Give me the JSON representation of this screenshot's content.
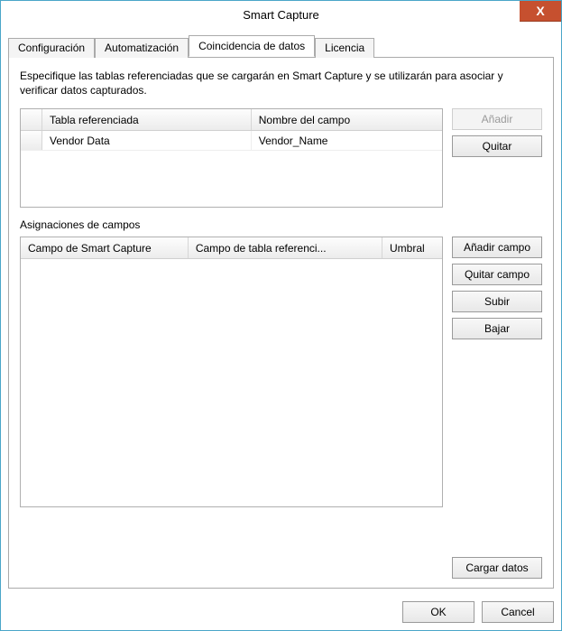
{
  "window": {
    "title": "Smart Capture",
    "close_glyph": "X"
  },
  "tabs": {
    "config": "Configuración",
    "automation": "Automatización",
    "datamatch": "Coincidencia de datos",
    "license": "Licencia"
  },
  "page": {
    "description": "Especifique las tablas referenciadas que se cargarán en Smart Capture y se utilizarán para asociar y verificar datos capturados.",
    "ref_table": {
      "headers": {
        "table": "Tabla referenciada",
        "field": "Nombre del campo"
      },
      "rows": [
        {
          "table": "Vendor Data",
          "field": "Vendor_Name"
        }
      ]
    },
    "ref_buttons": {
      "add": "Añadir",
      "remove": "Quitar"
    },
    "assignments_label": "Asignaciones de campos",
    "assign_table": {
      "headers": {
        "sc_field": "Campo de Smart Capture",
        "ref_field": "Campo de tabla referenci...",
        "threshold": "Umbral"
      }
    },
    "assign_buttons": {
      "add_field": "Añadir campo",
      "remove_field": "Quitar campo",
      "up": "Subir",
      "down": "Bajar",
      "load": "Cargar datos"
    }
  },
  "footer": {
    "ok": "OK",
    "cancel": "Cancel"
  }
}
